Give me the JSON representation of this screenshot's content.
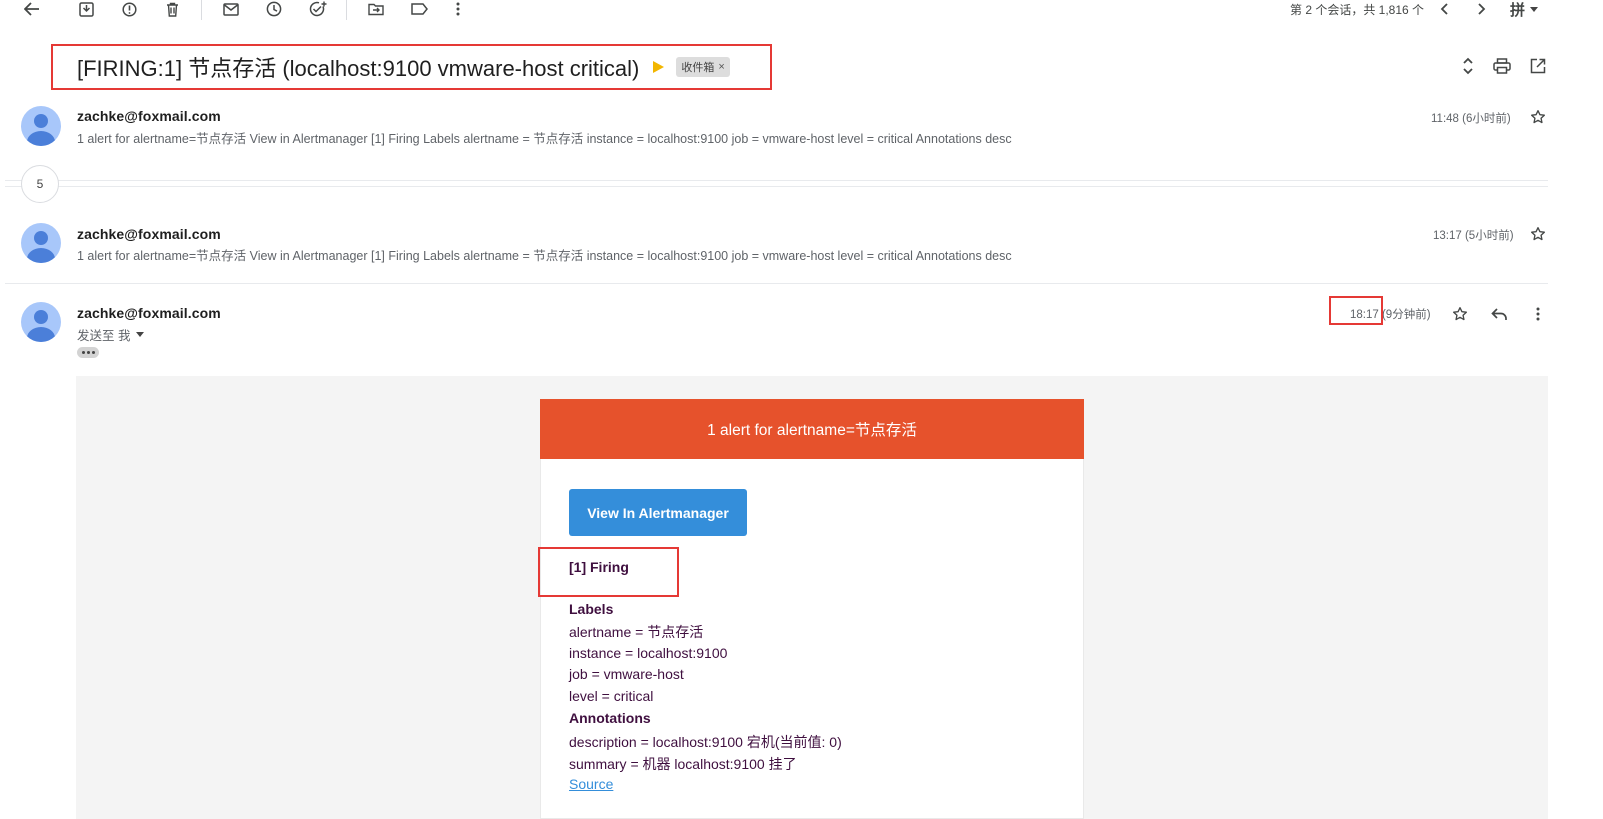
{
  "toolbar": {
    "counter": "第 2 个会话，共 1,816 个",
    "input_tool": "拼"
  },
  "thread": {
    "subject": "[FIRING:1] 节点存活 (localhost:9100 vmware-host critical)",
    "label_chip": "收件箱",
    "label_chip_close": "×",
    "collapsed_count": "5"
  },
  "messages": [
    {
      "sender": "zachke@foxmail.com",
      "snippet": "1 alert for alertname=节点存活 View in Alertmanager [1] Firing Labels alertname = 节点存活 instance = localhost:9100 job = vmware-host level = critical Annotations desc",
      "time": "11:48 (6小时前)"
    },
    {
      "sender": "zachke@foxmail.com",
      "snippet": "1 alert for alertname=节点存活 View in Alertmanager [1] Firing Labels alertname = 节点存活 instance = localhost:9100 job = vmware-host level = critical Annotations desc",
      "time": "13:17 (5小时前)"
    },
    {
      "sender": "zachke@foxmail.com",
      "recipient": "发送至 我",
      "time": "18:17 (9分钟前)"
    }
  ],
  "email_body": {
    "header": "1 alert for alertname=节点存活",
    "button": "View In Alertmanager",
    "firing": "[1] Firing",
    "labels_heading": "Labels",
    "labels": [
      "alertname = 节点存活",
      "instance = localhost:9100",
      "job = vmware-host",
      "level = critical"
    ],
    "annotations_heading": "Annotations",
    "annotations": [
      "description = localhost:9100 宕机(当前值: 0)",
      "summary = 机器 localhost:9100 挂了"
    ],
    "source_link": "Source"
  },
  "colors": {
    "alert_header": "#e6522c",
    "button": "#348eda",
    "text_dark_purple": "#3f0f3f",
    "annotation_red": "#e53935"
  },
  "icons": [
    "back-arrow-icon",
    "archive-icon",
    "report-spam-icon",
    "delete-icon",
    "mark-unread-icon",
    "snooze-icon",
    "add-task-icon",
    "move-to-icon",
    "label-icon",
    "more-vert-icon",
    "prev-icon",
    "next-icon",
    "expand-collapse-icon",
    "print-icon",
    "open-new-window-icon",
    "star-icon",
    "reply-icon"
  ]
}
